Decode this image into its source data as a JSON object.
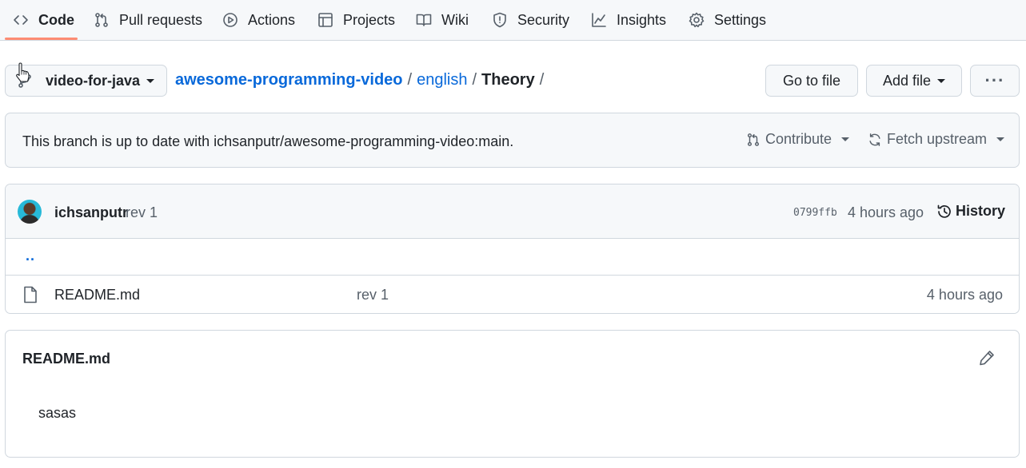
{
  "repo_nav": {
    "tabs": [
      {
        "label": "Code",
        "icon": "code-icon",
        "selected": true
      },
      {
        "label": "Pull requests",
        "icon": "git-pull-request-icon"
      },
      {
        "label": "Actions",
        "icon": "play-icon"
      },
      {
        "label": "Projects",
        "icon": "table-icon"
      },
      {
        "label": "Wiki",
        "icon": "book-icon"
      },
      {
        "label": "Security",
        "icon": "shield-icon"
      },
      {
        "label": "Insights",
        "icon": "graph-icon"
      },
      {
        "label": "Settings",
        "icon": "gear-icon"
      }
    ],
    "selected_underline_color": "#fd8c73"
  },
  "path_bar": {
    "branch": "video-for-java",
    "breadcrumb": {
      "repo": "awesome-programming-video",
      "separator": "/",
      "folder": "english",
      "current": "Theory"
    },
    "go_to_file": "Go to file",
    "add_file": "Add file",
    "more": "···"
  },
  "branch_status": {
    "text": "This branch is up to date with ichsanputr/awesome-programming-video:main.",
    "contribute": "Contribute",
    "fetch_upstream": "Fetch upstream"
  },
  "latest_commit": {
    "author": "ichsanputr",
    "message": "rev 1",
    "sha": "0799ffb",
    "time": "4 hours ago",
    "history": "History"
  },
  "files": {
    "parent": "..",
    "rows": [
      {
        "name": "README.md",
        "commit": "rev 1",
        "time": "4 hours ago",
        "icon": "file-icon"
      }
    ]
  },
  "readme": {
    "title": "README.md",
    "content": "sasas"
  },
  "colors": {
    "link": "#0969da",
    "muted": "#57606a",
    "border": "#d0d7de",
    "canvas_subtle": "#f6f8fa"
  }
}
